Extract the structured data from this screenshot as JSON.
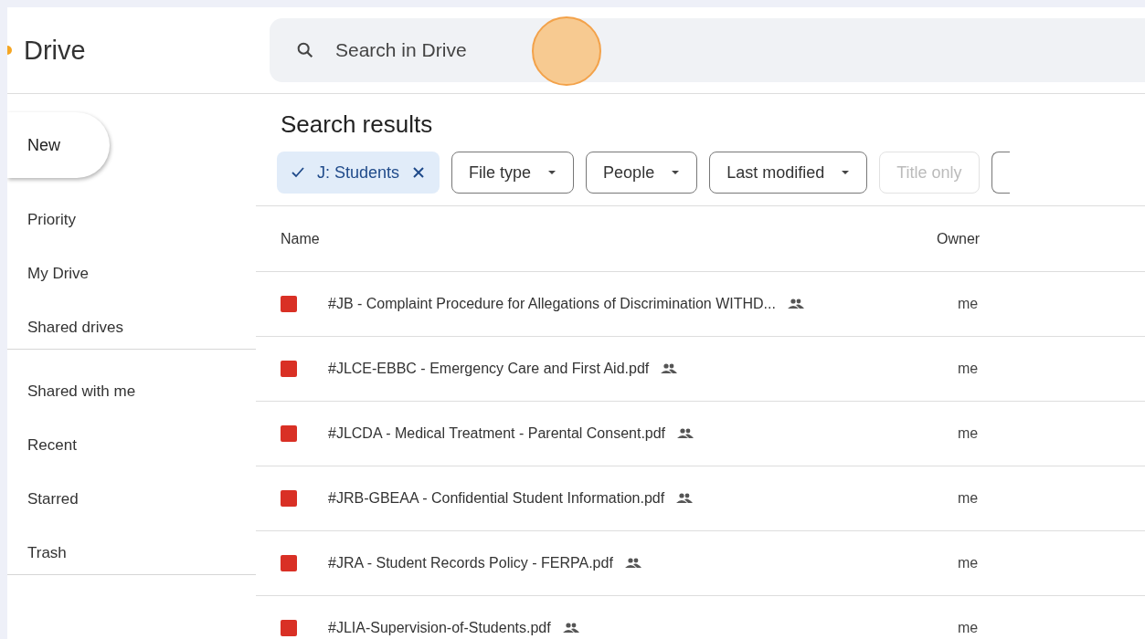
{
  "app": {
    "title": "Drive"
  },
  "search": {
    "placeholder": "Search in Drive"
  },
  "new_button": {
    "label": "New"
  },
  "sidebar": {
    "groups": [
      {
        "items": [
          {
            "label": "Priority",
            "selected": false
          },
          {
            "label": "My Drive",
            "selected": false
          },
          {
            "label": "Shared drives",
            "selected": false
          }
        ]
      },
      {
        "items": [
          {
            "label": "Shared with me",
            "selected": false
          },
          {
            "label": "Recent",
            "selected": false
          },
          {
            "label": "Starred",
            "selected": false
          },
          {
            "label": "Trash",
            "selected": false
          }
        ]
      }
    ]
  },
  "results": {
    "title": "Search results",
    "chips": [
      {
        "kind": "active",
        "label": "J: Students"
      },
      {
        "kind": "dropdown",
        "label": "File type"
      },
      {
        "kind": "dropdown",
        "label": "People"
      },
      {
        "kind": "dropdown",
        "label": "Last modified"
      },
      {
        "kind": "toggle",
        "label": "Title only",
        "disabled": true
      }
    ],
    "columns": [
      "Name",
      "Owner"
    ],
    "rows": [
      {
        "name": "#JB - Complaint Procedure for Allegations of Discrimination WITHD...",
        "shared": true,
        "owner": "me"
      },
      {
        "name": "#JLCE-EBBC - Emergency Care and First Aid.pdf",
        "shared": true,
        "owner": "me"
      },
      {
        "name": "#JLCDA - Medical Treatment - Parental Consent.pdf",
        "shared": true,
        "owner": "me"
      },
      {
        "name": "#JRB-GBEAA - Confidential Student Information.pdf",
        "shared": true,
        "owner": "me"
      },
      {
        "name": "#JRA - Student Records Policy - FERPA.pdf",
        "shared": true,
        "owner": "me"
      },
      {
        "name": "#JLIA-Supervision-of-Students.pdf",
        "shared": true,
        "owner": "me"
      }
    ]
  }
}
